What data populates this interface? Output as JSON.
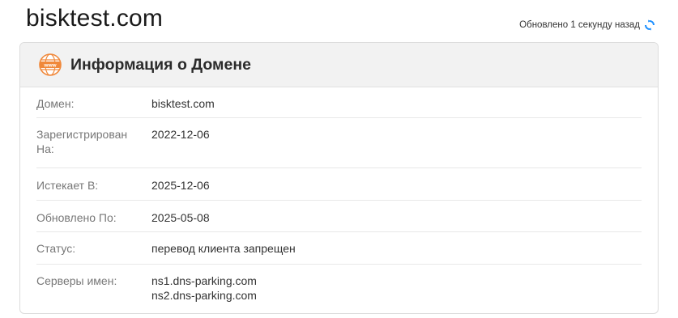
{
  "domain": "bisktest.com",
  "updated_text": "Обновлено 1 секунду назад",
  "accent_color": "#1e90ff",
  "icon_color": "#f0883a",
  "card": {
    "title": "Информация о Домене",
    "rows": [
      {
        "label": "Домен:",
        "value": "bisktest.com"
      },
      {
        "label_line1": "Зарегистрирован",
        "label_line2": "На:",
        "value": "2022-12-06"
      },
      {
        "label": "Истекает В:",
        "value": "2025-12-06"
      },
      {
        "label": "Обновлено По:",
        "value": "2025-05-08"
      },
      {
        "label": "Статус:",
        "value": "перевод клиента запрещен"
      },
      {
        "label": "Серверы имен:",
        "values": [
          "ns1.dns-parking.com",
          "ns2.dns-parking.com"
        ]
      }
    ]
  }
}
